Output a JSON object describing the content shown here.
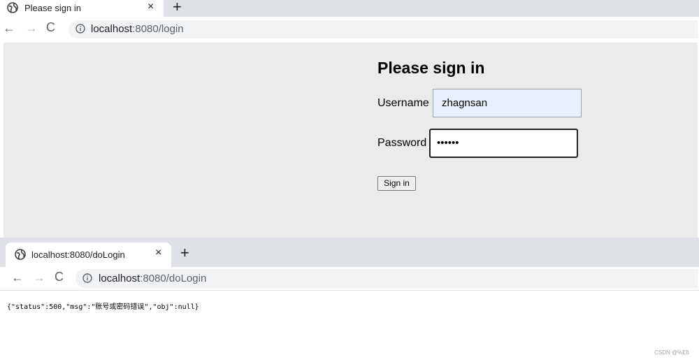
{
  "browser1": {
    "tab": {
      "title": "Please sign in",
      "close": "×",
      "icon": "globe-icon"
    },
    "new_tab": "+",
    "nav": {
      "back": "←",
      "forward": "→",
      "reload": "C"
    },
    "address": {
      "host": "localhost",
      "path": ":8080/login"
    },
    "form": {
      "title": "Please sign in",
      "username_label": "Username",
      "username_value": "zhagnsan",
      "password_label": "Password",
      "password_value": "••••••",
      "submit_label": "Sign in"
    }
  },
  "browser2": {
    "tab": {
      "title": "localhost:8080/doLogin",
      "close": "×",
      "icon": "globe-icon"
    },
    "new_tab": "+",
    "nav": {
      "back": "←",
      "forward": "→",
      "reload": "C"
    },
    "address": {
      "host": "localhost",
      "path": ":8080/doLogin"
    },
    "response_text": "{\"status\":500,\"msg\":\"账号或密码错误\",\"obj\":null}"
  },
  "watermark": "CSDN @%E6"
}
